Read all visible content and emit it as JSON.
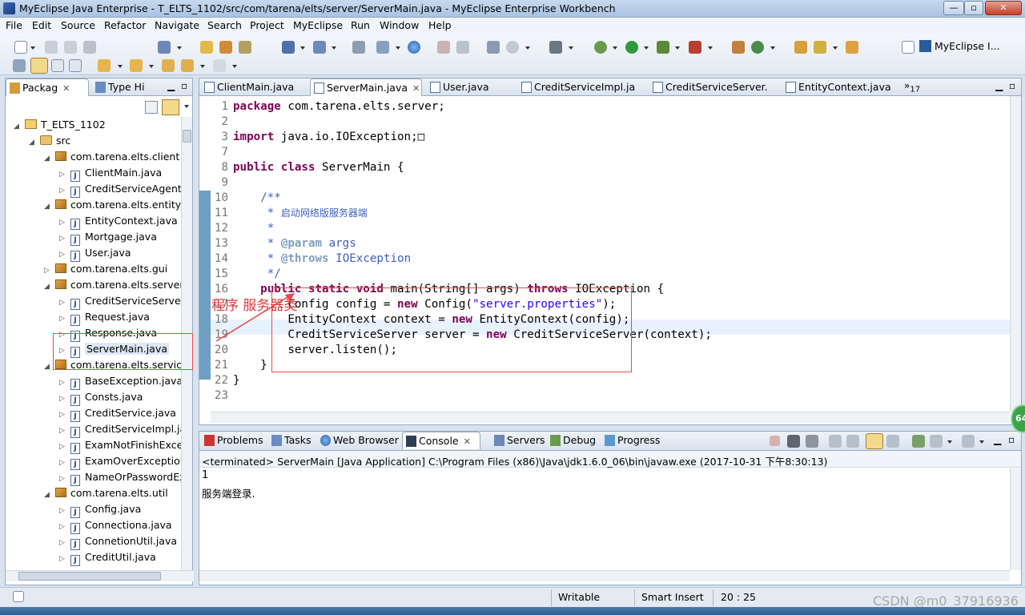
{
  "window": {
    "title": "MyEclipse Java Enterprise - T_ELTS_1102/src/com/tarena/elts/server/ServerMain.java - MyEclipse Enterprise Workbench"
  },
  "menu": [
    "File",
    "Edit",
    "Source",
    "Refactor",
    "Navigate",
    "Search",
    "Project",
    "MyEclipse",
    "Run",
    "Window",
    "Help"
  ],
  "perspective_label": "MyEclipse I...",
  "explorer": {
    "tabs": [
      "Packag",
      "Type Hi"
    ],
    "tree": [
      {
        "label": "T_ELTS_1102",
        "kind": "project",
        "level": 0,
        "expanded": true
      },
      {
        "label": "src",
        "kind": "src",
        "level": 1,
        "expanded": true
      },
      {
        "label": "com.tarena.elts.client",
        "kind": "package",
        "level": 2,
        "expanded": true
      },
      {
        "label": "ClientMain.java",
        "kind": "java",
        "level": 3
      },
      {
        "label": "CreditServiceAgentIr",
        "kind": "java",
        "level": 3
      },
      {
        "label": "com.tarena.elts.entity",
        "kind": "package",
        "level": 2,
        "expanded": true
      },
      {
        "label": "EntityContext.java",
        "kind": "java",
        "level": 3
      },
      {
        "label": "Mortgage.java",
        "kind": "java",
        "level": 3
      },
      {
        "label": "User.java",
        "kind": "java",
        "level": 3
      },
      {
        "label": "com.tarena.elts.gui",
        "kind": "package",
        "level": 2,
        "expanded": false
      },
      {
        "label": "com.tarena.elts.server",
        "kind": "package",
        "level": 2,
        "expanded": true
      },
      {
        "label": "CreditServiceServer.",
        "kind": "java",
        "level": 3
      },
      {
        "label": "Request.java",
        "kind": "java",
        "level": 3
      },
      {
        "label": "Response.java",
        "kind": "java",
        "level": 3
      },
      {
        "label": "ServerMain.java",
        "kind": "java",
        "level": 3,
        "selected": true
      },
      {
        "label": "com.tarena.elts.service",
        "kind": "package",
        "level": 2,
        "expanded": true
      },
      {
        "label": "BaseException.java",
        "kind": "java",
        "level": 3
      },
      {
        "label": "Consts.java",
        "kind": "java",
        "level": 3
      },
      {
        "label": "CreditService.java",
        "kind": "java",
        "level": 3
      },
      {
        "label": "CreditServiceImpl.jav",
        "kind": "java",
        "level": 3
      },
      {
        "label": "ExamNotFinishExcep",
        "kind": "java",
        "level": 3
      },
      {
        "label": "ExamOverException.",
        "kind": "java",
        "level": 3
      },
      {
        "label": "NameOrPasswordEx",
        "kind": "java",
        "level": 3
      },
      {
        "label": "com.tarena.elts.util",
        "kind": "package",
        "level": 2,
        "expanded": true
      },
      {
        "label": "Config.java",
        "kind": "java",
        "level": 3
      },
      {
        "label": "Connectiona.java",
        "kind": "java",
        "level": 3
      },
      {
        "label": "ConnetionUtil.java",
        "kind": "java",
        "level": 3
      },
      {
        "label": "CreditUtil.java",
        "kind": "java",
        "level": 3
      }
    ]
  },
  "editor": {
    "tabs": [
      {
        "label": "ClientMain.java",
        "active": false
      },
      {
        "label": "ServerMain.java",
        "active": true
      },
      {
        "label": "User.java",
        "active": false
      },
      {
        "label": "CreditServiceImpl.ja",
        "active": false
      },
      {
        "label": "CreditServiceServer.",
        "active": false
      },
      {
        "label": "EntityContext.java",
        "active": false
      }
    ],
    "overflow_count": "17",
    "lines": [
      {
        "n": "1",
        "html": "<span class='kw'>package</span> com.tarena.elts.server;"
      },
      {
        "n": "2",
        "html": ""
      },
      {
        "n": "3",
        "html": "<span class='kw'>import</span> java.io.IOException;&#9633;"
      },
      {
        "n": "7",
        "html": ""
      },
      {
        "n": "8",
        "html": "<span class='kw'>public class</span> ServerMain {"
      },
      {
        "n": "9",
        "html": ""
      },
      {
        "n": "10",
        "html": "    <span class='doc'>/**</span>"
      },
      {
        "n": "11",
        "html": "     <span class='doc'>* </span><span class='cn'>启动网络版服务器端</span>"
      },
      {
        "n": "12",
        "html": "     <span class='doc'>*</span>"
      },
      {
        "n": "13",
        "html": "     <span class='doc'>* </span><span class='tag'>@param</span><span class='doc'> args</span>"
      },
      {
        "n": "14",
        "html": "     <span class='doc'>* </span><span class='tag'>@throws</span><span class='doc'> IOException</span>"
      },
      {
        "n": "15",
        "html": "     <span class='doc'>*/</span>"
      },
      {
        "n": "16",
        "html": "    <span class='kw'>public static void</span> main(String[] args) <span class='kw'>throws</span> IOException {"
      },
      {
        "n": "17",
        "html": "        Config config = <span class='kw'>new</span> Config(<span class='str'>\"server.properties\"</span>);"
      },
      {
        "n": "18",
        "html": "        EntityContext context = <span class='kw'>new</span> EntityContext(config);"
      },
      {
        "n": "19",
        "html": "        CreditServiceServer server = <span class='kw'>new</span> CreditServiceServer(context);"
      },
      {
        "n": "20",
        "html": "        server.listen();"
      },
      {
        "n": "21",
        "html": "    }"
      },
      {
        "n": "22",
        "html": "}"
      },
      {
        "n": "23",
        "html": ""
      }
    ]
  },
  "annotation_text": "程序 服务器类",
  "console": {
    "tabs": [
      "Problems",
      "Tasks",
      "Web Browser",
      "Console",
      "Servers",
      "Debug",
      "Progress"
    ],
    "header": "<terminated> ServerMain [Java Application] C:\\Program Files (x86)\\Java\\jdk1.6.0_06\\bin\\javaw.exe (2017-10-31 下午8:30:13)",
    "output": [
      "1",
      "服务端登录."
    ]
  },
  "status": {
    "writable": "Writable",
    "insert_mode": "Smart Insert",
    "position": "20 : 25"
  },
  "watermark": "CSDN @m0_37916936",
  "badge": "64",
  "colors": {
    "accent": "#6f9fc4",
    "annotation": "#e84a4a",
    "keyword": "#7f0055",
    "string": "#2a00ff",
    "javadoc": "#3f5fbf"
  }
}
